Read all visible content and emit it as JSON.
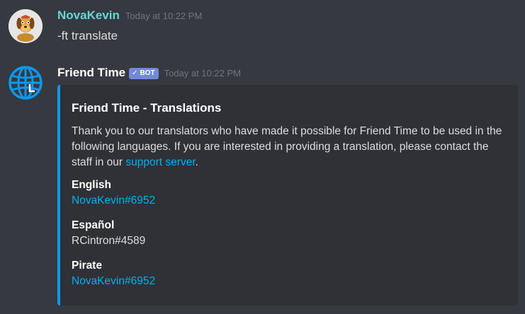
{
  "messages": [
    {
      "author": "NovaKevin",
      "author_color": "#62d8d8",
      "timestamp": "Today at 10:22 PM",
      "avatar_icon": "dog-avatar-icon",
      "content": "-ft translate"
    },
    {
      "author": "Friend Time",
      "author_color": "#ffffff",
      "timestamp": "Today at 10:22 PM",
      "avatar_icon": "globe-clock-icon",
      "bot_tag": "BOT",
      "bot_tag_check": "✓",
      "embed": {
        "accent_color": "#0c98f0",
        "title": "Friend Time - Translations",
        "description_before_link": "Thank you to our translators who have made it possible for Friend Time to be used in the following languages. If you are interested in providing a translation, please contact the staff in our ",
        "description_link": "support server",
        "description_after_link": ".",
        "fields": [
          {
            "name": "English",
            "value": "NovaKevin#6952",
            "is_link": true
          },
          {
            "name": "Español",
            "value": "RCintron#4589",
            "is_link": false
          },
          {
            "name": "Pirate",
            "value": "NovaKevin#6952",
            "is_link": true
          }
        ]
      }
    }
  ],
  "colors": {
    "background": "#36393f",
    "embed_background": "#2f3136",
    "link": "#00b0f4",
    "bot_tag": "#7289da"
  }
}
